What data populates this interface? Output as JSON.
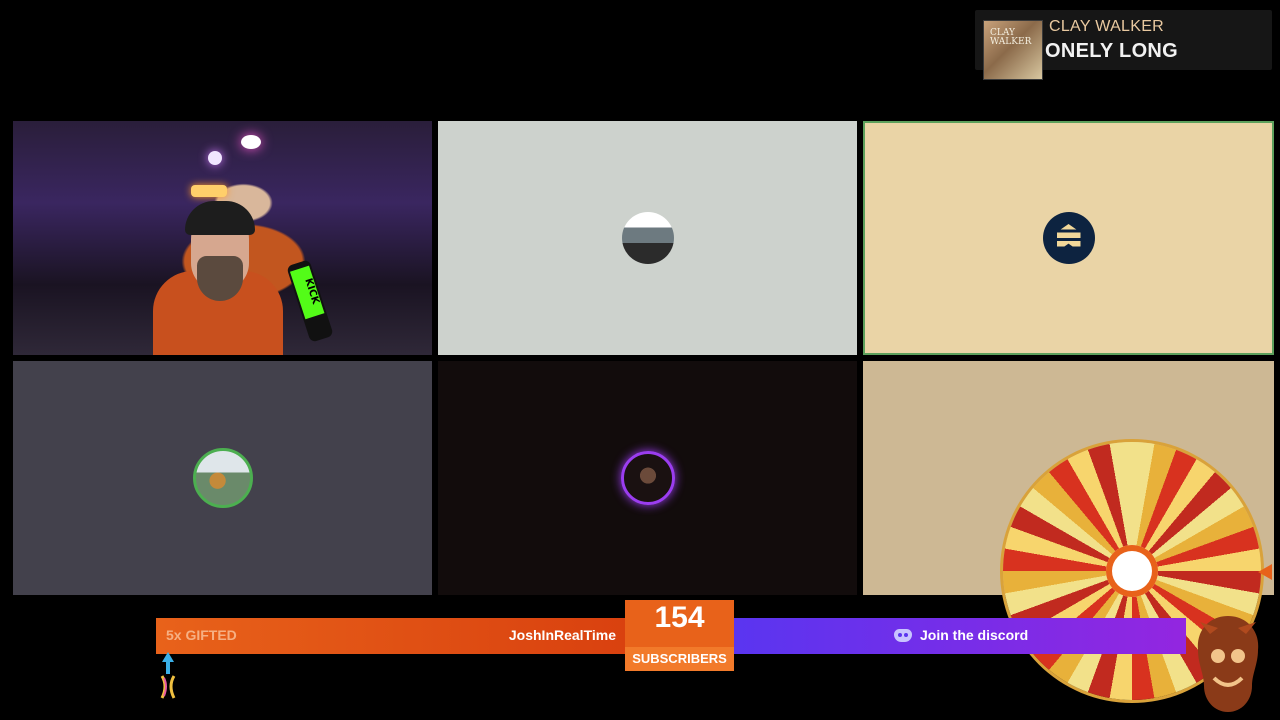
{
  "now_playing": {
    "artist": "CLAY WALKER",
    "title": "ONELY LONG",
    "album_art_text": "CLAY WALKER",
    "icon": "album-art"
  },
  "call_grid": {
    "tiles": [
      {
        "label": "webcam-host",
        "background": "#2a1e3a"
      },
      {
        "label": "participant-2",
        "background": "#cdd2cd",
        "icon": "avatar-boat"
      },
      {
        "label": "participant-3",
        "background": "#ead4a6",
        "icon": "avatar-chevron",
        "speaking": true
      },
      {
        "label": "participant-4",
        "background": "#43414c",
        "icon": "avatar-bear"
      },
      {
        "label": "participant-5",
        "background": "#120c0c",
        "icon": "avatar-skull"
      },
      {
        "label": "participant-6",
        "background": "#cdb894"
      }
    ],
    "host_mic_logo": "KICK"
  },
  "ticker": {
    "gifted_label": "5x GIFTED",
    "username": "JoshInRealTime",
    "subscriber_count": "154",
    "subscriber_label": "SUBSCRIBERS",
    "discord_label": "Join the discord"
  },
  "colors": {
    "ticker_orange": "#e8621a",
    "discord_purple": "#5a35f0",
    "speaking_green": "#5ca05c",
    "avatar_ring_green": "#4caf50",
    "avatar_ring_purple": "#9b3df0"
  },
  "wheel": {
    "icon": "spin-wheel"
  }
}
